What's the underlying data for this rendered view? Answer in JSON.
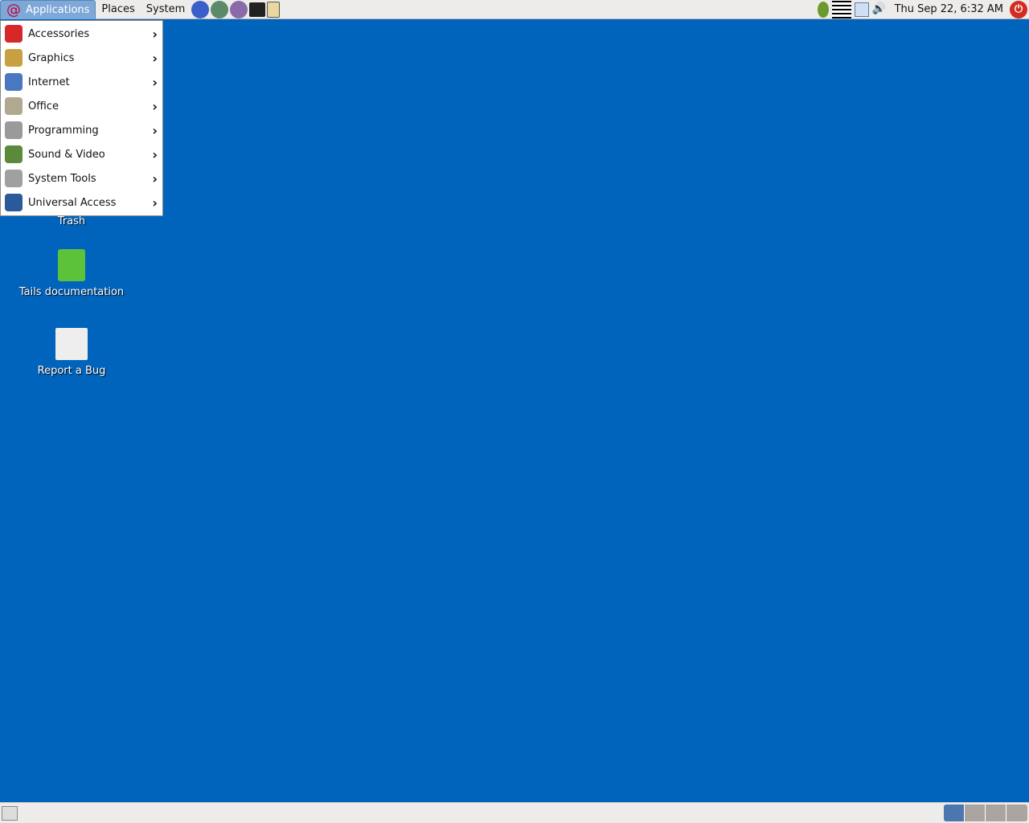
{
  "top_panel": {
    "menus": [
      "Applications",
      "Places",
      "System"
    ],
    "launchers": [
      "web-browser-icon",
      "email-client-icon",
      "pidgin-icon",
      "terminal-icon",
      "help-icon"
    ],
    "tray_icons": [
      "tor-onion-icon",
      "keyboard-icon",
      "network-icon",
      "volume-icon"
    ],
    "clock": "Thu Sep 22,  6:32 AM",
    "shutdown_icon": "power-icon"
  },
  "applications_menu": [
    {
      "label": "Accessories",
      "icon": "accessories-icon",
      "color": "#d62828"
    },
    {
      "label": "Graphics",
      "icon": "graphics-icon",
      "color": "#c8a040"
    },
    {
      "label": "Internet",
      "icon": "internet-icon",
      "color": "#4a78c0"
    },
    {
      "label": "Office",
      "icon": "office-icon",
      "color": "#b0a890"
    },
    {
      "label": "Programming",
      "icon": "programming-icon",
      "color": "#9a9a9a"
    },
    {
      "label": "Sound & Video",
      "icon": "sound-video-icon",
      "color": "#5a8a3a"
    },
    {
      "label": "System Tools",
      "icon": "system-tools-icon",
      "color": "#a0a0a0"
    },
    {
      "label": "Universal Access",
      "icon": "universal-access-icon",
      "color": "#2a5a9a"
    }
  ],
  "desktop_icons": [
    {
      "label": "Trash"
    },
    {
      "label": "Tails documentation"
    },
    {
      "label": "Report a Bug"
    }
  ],
  "bottom_panel": {
    "workspaces": 4,
    "active_workspace": 1
  },
  "colors": {
    "desktop": "#0064bd",
    "menu_highlight": "#7ea8d8",
    "active_workspace": "#4a77b0"
  }
}
